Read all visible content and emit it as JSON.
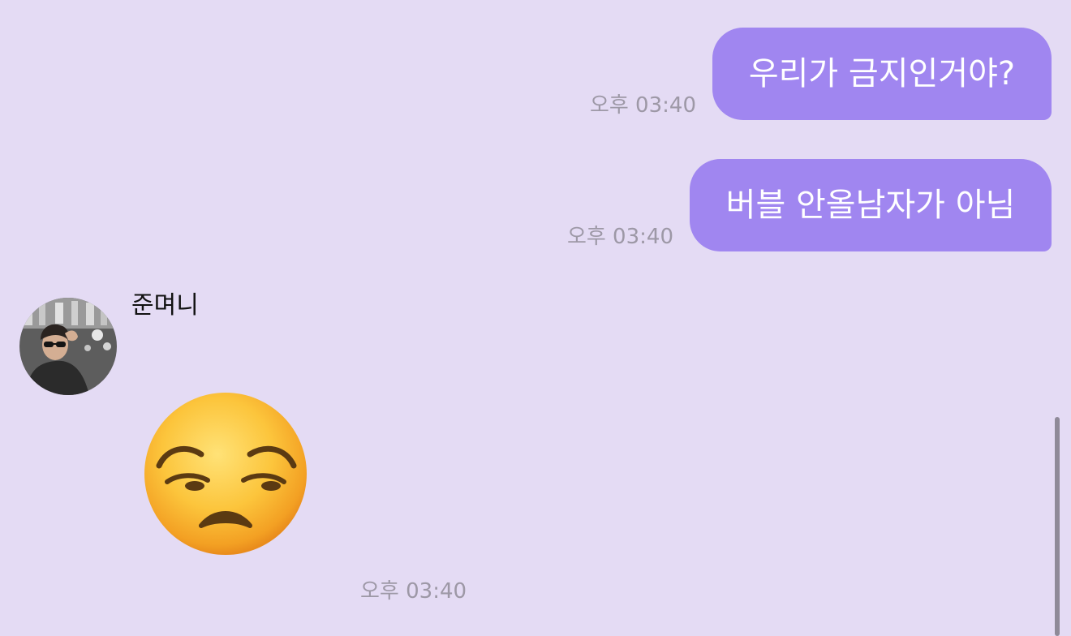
{
  "colors": {
    "background": "#e4dbf4",
    "outgoing_bubble": "#a086f0",
    "outgoing_text": "#ffffff",
    "timestamp": "#9d98a6"
  },
  "messages": [
    {
      "direction": "outgoing",
      "text": "우리가 금지인거야?",
      "time": "오후 03:40"
    },
    {
      "direction": "outgoing",
      "text": "버블 안올남자가 아님",
      "time": "오후 03:40"
    },
    {
      "direction": "incoming",
      "sender": "준며니",
      "avatar_icon": "profile-photo-avatar",
      "sticker_icon": "unamused-face-emoji",
      "time": "오후 03:40"
    }
  ],
  "scrollbar": {
    "visible": true
  }
}
